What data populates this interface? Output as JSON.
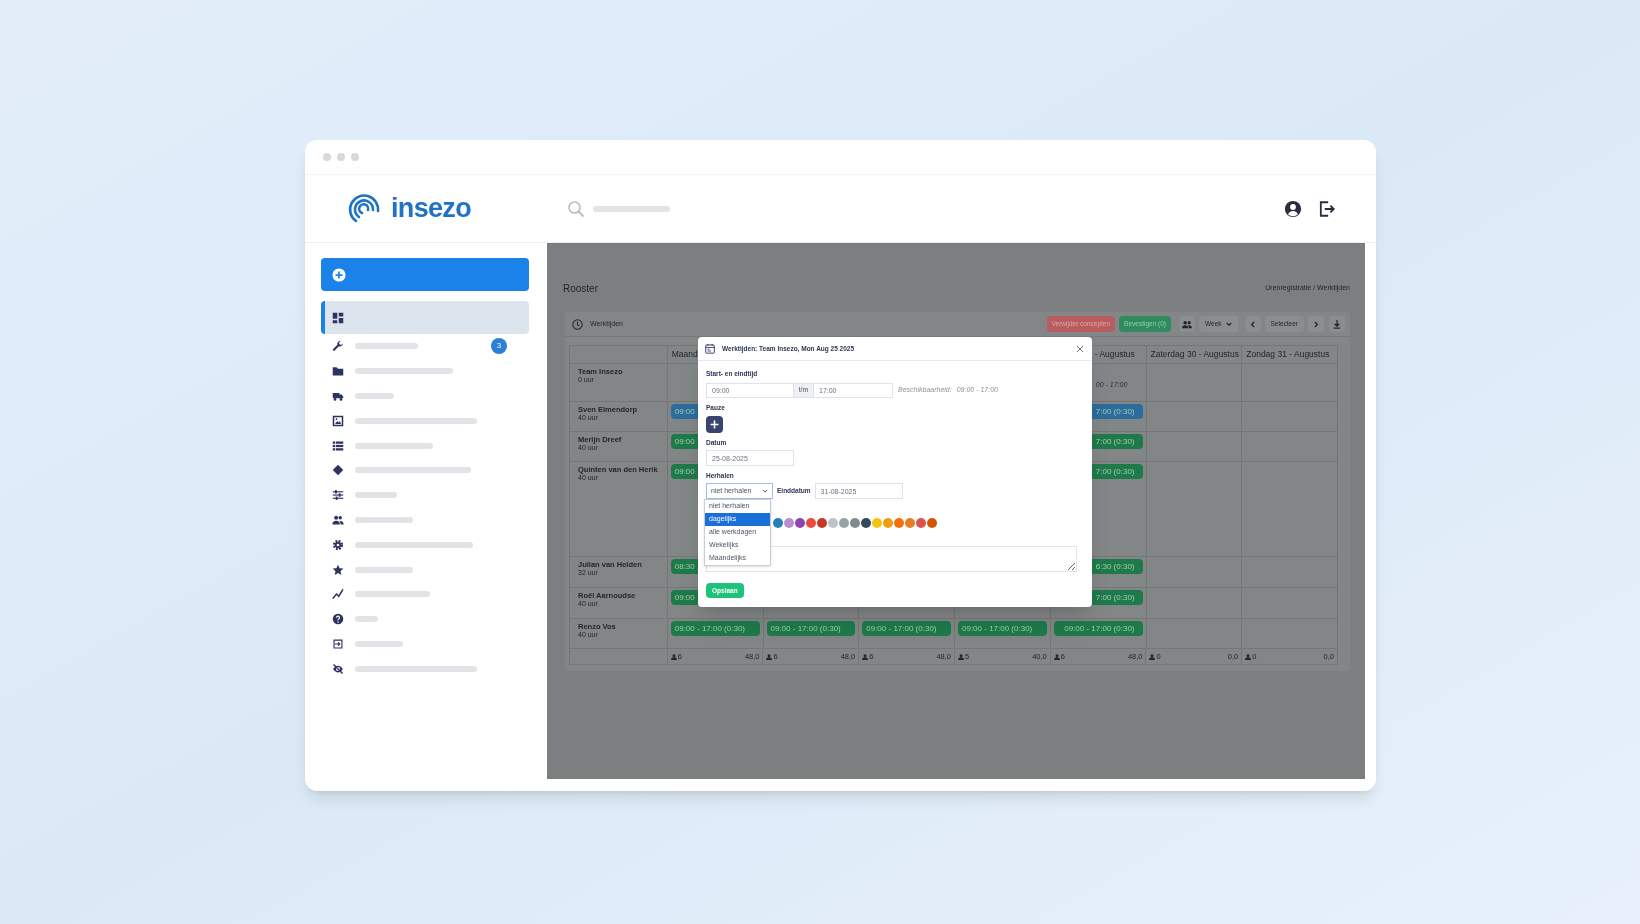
{
  "window": {
    "logo_text": "insezo"
  },
  "sidebar": {
    "items": [
      {
        "selected": true
      },
      {
        "selected": false,
        "badge": "3"
      },
      {
        "selected": false
      },
      {
        "selected": false
      },
      {
        "selected": false
      },
      {
        "selected": false
      },
      {
        "selected": false
      },
      {
        "selected": false
      },
      {
        "selected": false
      },
      {
        "selected": false
      },
      {
        "selected": false
      },
      {
        "selected": false
      },
      {
        "selected": false
      },
      {
        "selected": false
      },
      {
        "selected": false
      }
    ]
  },
  "page": {
    "title": "Rooster",
    "breadcrumb": "Urenregistratie / Werktijden"
  },
  "schedule": {
    "title": "Werktijden",
    "toolbar": [
      {
        "kind": "danger",
        "label": "Verwijder concepten"
      },
      {
        "kind": "success",
        "label": "Bevestigen (0)"
      },
      {
        "kind": "team"
      },
      {
        "kind": "dropdown",
        "label": "Week"
      },
      {
        "kind": "prev"
      },
      {
        "kind": "plain",
        "label": "Selecteer"
      },
      {
        "kind": "next"
      },
      {
        "kind": "download"
      }
    ],
    "columns": [
      {
        "label": "Maand"
      },
      {},
      {},
      {},
      {
        "label": "- Augustus"
      },
      {
        "label": "Zaterdag 30 - Augustus"
      },
      {
        "label": "Zondag 31 - Augustus"
      }
    ],
    "rows": [
      {
        "name": "Team Insezo",
        "hours": "0 uur",
        "cells": [
          {},
          {},
          {},
          {},
          {
            "kind": "availability",
            "text": "00 - 17:00"
          },
          {},
          {}
        ]
      },
      {
        "name": "Sven Elmendorp",
        "hours": "40 uur",
        "cells": [
          {
            "kind": "shift",
            "color": "#2b6c9c",
            "text": "09:00"
          },
          {},
          {},
          {},
          {
            "kind": "shift",
            "color": "#2b6c9c",
            "text": "7:00 (0:30)"
          },
          {},
          {}
        ]
      },
      {
        "name": "Merijn Dreef",
        "hours": "40 uur",
        "cells": [
          {
            "kind": "shift",
            "color": "#1f7a4a",
            "text": "09:00"
          },
          {},
          {},
          {},
          {
            "kind": "shift",
            "color": "#1f7a4a",
            "text": "7:00 (0:30)"
          },
          {},
          {}
        ]
      },
      {
        "name": "Quinten van den Herik",
        "hours": "40 uur",
        "cells": [
          {
            "kind": "shift",
            "color": "#1f7a4a",
            "text": "09:00"
          },
          {},
          {},
          {},
          {
            "kind": "shift",
            "color": "#1f7a4a",
            "text": "7:00 (0:30)"
          },
          {},
          {}
        ]
      },
      {
        "name": "Julian van Helden",
        "hours": "32 uur",
        "cells": [
          {
            "kind": "shift",
            "color": "#1f7a4a",
            "text": "08:30"
          },
          {},
          {},
          {},
          {
            "kind": "shift",
            "color": "#1f7a4a",
            "text": "6:30 (0:30)"
          },
          {},
          {}
        ]
      },
      {
        "name": "Roël Aarnoudse",
        "hours": "40 uur",
        "cells": [
          {
            "kind": "shift",
            "color": "#1f7a4a",
            "text": "09:00"
          },
          {},
          {},
          {},
          {
            "kind": "shift",
            "color": "#1f7a4a",
            "text": "7:00 (0:30)"
          },
          {},
          {}
        ]
      },
      {
        "name": "Renzo Vos",
        "hours": "40 uur",
        "cells": [
          {
            "kind": "shift",
            "color": "#1f7a4a",
            "text": "09:00 - 17:00 (0:30)"
          },
          {
            "kind": "shift",
            "color": "#1f7a4a",
            "text": "09:00 - 17:00 (0:30)"
          },
          {
            "kind": "shift",
            "color": "#1f7a4a",
            "text": "09:00 - 17:00 (0:30)"
          },
          {
            "kind": "shift",
            "color": "#1f7a4a",
            "text": "09:00 - 17:00 (0:30)"
          },
          {
            "kind": "shift",
            "color": "#1f7a4a",
            "text": "09:00 - 17:00 (0:30)"
          },
          {},
          {}
        ]
      }
    ],
    "totals": [
      {
        "people": "6",
        "hours": "48,0"
      },
      {
        "people": "6",
        "hours": "48,0"
      },
      {
        "people": "6",
        "hours": "48,0"
      },
      {
        "people": "5",
        "hours": "40,0"
      },
      {
        "people": "6",
        "hours": "48,0"
      },
      {
        "people": "0",
        "hours": "0,0"
      },
      {
        "people": "0",
        "hours": "0,0"
      }
    ]
  },
  "modal": {
    "title": "Werktijden: Team Insezo, Mon Aug 25 2025",
    "time_label": "Start- en eindtijd",
    "start": "09:00",
    "separator": "t/m",
    "end": "17:00",
    "availability_label": "Beschikbaarheid:",
    "availability_value": "09:00 - 17:00",
    "pause_label": "Pauze",
    "date_label": "Datum",
    "date": "25-08-2025",
    "repeat_label": "Herhalen",
    "repeat_value": "niet herhalen",
    "end_date_label": "Einddatum",
    "end_date": "31-08-2025",
    "repeat_options": [
      {
        "label": "niet herhalen",
        "selected": false
      },
      {
        "label": "dagelijks",
        "selected": true
      },
      {
        "label": "alle werkdagen",
        "selected": false
      },
      {
        "label": "Wekelijks",
        "selected": false
      },
      {
        "label": "Maandelijks",
        "selected": false
      }
    ],
    "colors": [
      {
        "color": "#2980b9"
      },
      {
        "color": "#bb8fce"
      },
      {
        "color": "#8e44ad"
      },
      {
        "color": "#e74c3c"
      },
      {
        "color": "#c0392b"
      },
      {
        "color": "#bdc3c7"
      },
      {
        "color": "#95a5a6"
      },
      {
        "color": "#7f8c8d"
      },
      {
        "color": "#34495e"
      },
      {
        "color": "#f1c40f"
      },
      {
        "color": "#f39c12"
      },
      {
        "color": "#f5700a"
      },
      {
        "color": "#e67e22"
      },
      {
        "color": "#d9534f"
      },
      {
        "color": "#d35400"
      }
    ],
    "save": "Opslaan"
  }
}
